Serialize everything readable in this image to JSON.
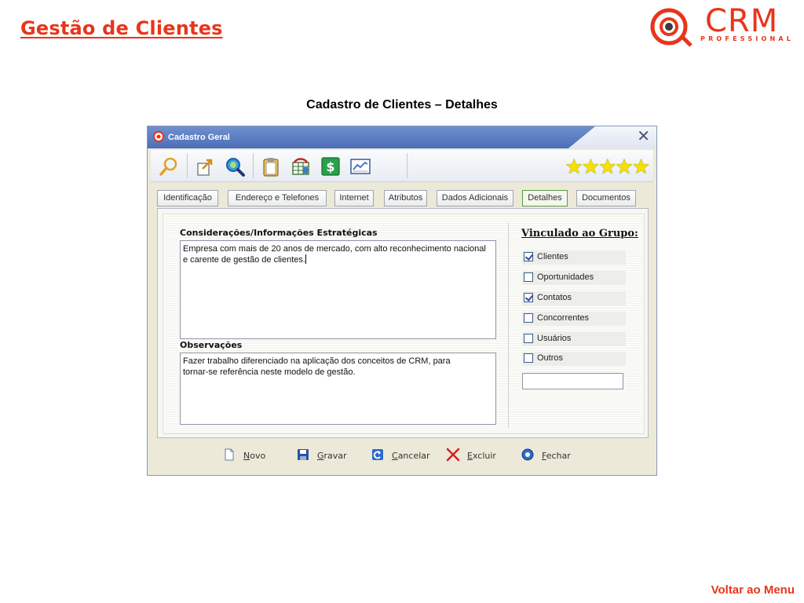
{
  "slide": {
    "title": "Gestão de Clientes",
    "heading": "Cadastro de Clientes – Detalhes",
    "back_link": "Voltar ao Menu"
  },
  "logo": {
    "text": "CRM",
    "subtitle": "PROFESSIONAL",
    "color": "#e8351b"
  },
  "window": {
    "title": "Cadastro Geral",
    "toolbar_icons": [
      "search-icon",
      "export-icon",
      "zoom-icon",
      "clipboard-icon",
      "data-grid-icon",
      "dollar-icon",
      "chart-icon"
    ],
    "rating": "★★★★★",
    "tabs": [
      {
        "label": "Identificação"
      },
      {
        "label": "Endereço e Telefones"
      },
      {
        "label": "Internet"
      },
      {
        "label": "Atributos"
      },
      {
        "label": "Dados Adicionais"
      },
      {
        "label": "Detalhes"
      },
      {
        "label": "Documentos"
      }
    ],
    "active_tab": "Detalhes",
    "strategic": {
      "label": "Considerações/Informações Estratégicas",
      "line1": "Empresa com mais de 20 anos de mercado, com alto reconhecimento nacional",
      "line2": "e carente de gestão de clientes."
    },
    "observations": {
      "label": "Observações",
      "line1": "Fazer trabalho diferenciado na aplicação dos conceitos de CRM, para",
      "line2": "tornar-se referência neste modelo de gestão."
    },
    "group": {
      "title": "Vinculado ao Grupo:",
      "items": [
        {
          "label": "Clientes",
          "checked": true
        },
        {
          "label": "Oportunidades",
          "checked": false
        },
        {
          "label": "Contatos",
          "checked": true
        },
        {
          "label": "Concorrentes",
          "checked": false
        },
        {
          "label": "Usuários",
          "checked": false
        },
        {
          "label": "Outros",
          "checked": false
        }
      ],
      "other_value": ""
    },
    "footer": {
      "novo": {
        "hotkey": "N",
        "rest": "ovo"
      },
      "gravar": {
        "hotkey": "G",
        "rest": "ravar"
      },
      "cancelar": {
        "hotkey": "C",
        "rest": "ancelar"
      },
      "excluir": {
        "hotkey": "E",
        "rest": "xcluir"
      },
      "fechar": {
        "hotkey": "F",
        "rest": "echar"
      }
    }
  }
}
